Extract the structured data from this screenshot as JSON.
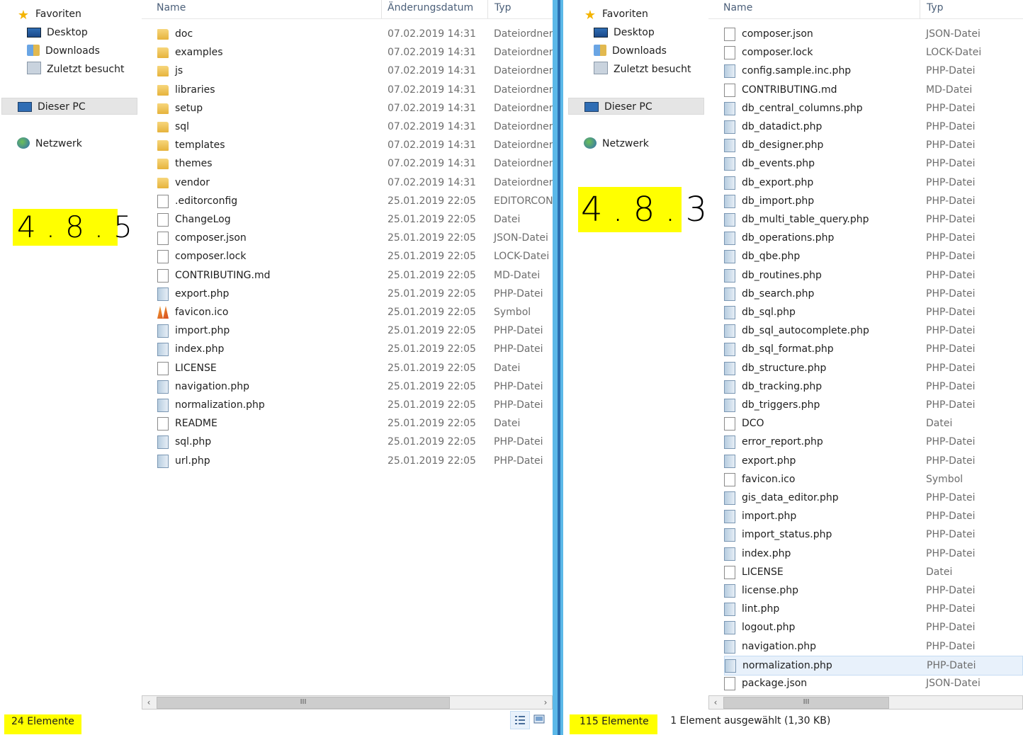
{
  "nav": {
    "favorites": "Favoriten",
    "desktop": "Desktop",
    "downloads": "Downloads",
    "recent": "Zuletzt besucht",
    "this_pc": "Dieser PC",
    "network": "Netzwerk"
  },
  "left": {
    "headers": {
      "name": "Name",
      "date": "Änderungsdatum",
      "type": "Typ"
    },
    "annotation": "4.8.5",
    "status_count": "24 Elemente",
    "files": [
      {
        "name": "doc",
        "date": "07.02.2019 14:31",
        "type": "Dateiordner",
        "icon": "folder"
      },
      {
        "name": "examples",
        "date": "07.02.2019 14:31",
        "type": "Dateiordner",
        "icon": "folder"
      },
      {
        "name": "js",
        "date": "07.02.2019 14:31",
        "type": "Dateiordner",
        "icon": "folder"
      },
      {
        "name": "libraries",
        "date": "07.02.2019 14:31",
        "type": "Dateiordner",
        "icon": "folder"
      },
      {
        "name": "setup",
        "date": "07.02.2019 14:31",
        "type": "Dateiordner",
        "icon": "folder"
      },
      {
        "name": "sql",
        "date": "07.02.2019 14:31",
        "type": "Dateiordner",
        "icon": "folder"
      },
      {
        "name": "templates",
        "date": "07.02.2019 14:31",
        "type": "Dateiordner",
        "icon": "folder"
      },
      {
        "name": "themes",
        "date": "07.02.2019 14:31",
        "type": "Dateiordner",
        "icon": "folder"
      },
      {
        "name": "vendor",
        "date": "07.02.2019 14:31",
        "type": "Dateiordner",
        "icon": "folder"
      },
      {
        "name": ".editorconfig",
        "date": "25.01.2019 22:05",
        "type": "EDITORCON",
        "icon": "file"
      },
      {
        "name": "ChangeLog",
        "date": "25.01.2019 22:05",
        "type": "Datei",
        "icon": "file"
      },
      {
        "name": "composer.json",
        "date": "25.01.2019 22:05",
        "type": "JSON-Datei",
        "icon": "file"
      },
      {
        "name": "composer.lock",
        "date": "25.01.2019 22:05",
        "type": "LOCK-Datei",
        "icon": "file"
      },
      {
        "name": "CONTRIBUTING.md",
        "date": "25.01.2019 22:05",
        "type": "MD-Datei",
        "icon": "file"
      },
      {
        "name": "export.php",
        "date": "25.01.2019 22:05",
        "type": "PHP-Datei",
        "icon": "php"
      },
      {
        "name": "favicon.ico",
        "date": "25.01.2019 22:05",
        "type": "Symbol",
        "icon": "fav"
      },
      {
        "name": "import.php",
        "date": "25.01.2019 22:05",
        "type": "PHP-Datei",
        "icon": "php"
      },
      {
        "name": "index.php",
        "date": "25.01.2019 22:05",
        "type": "PHP-Datei",
        "icon": "php"
      },
      {
        "name": "LICENSE",
        "date": "25.01.2019 22:05",
        "type": "Datei",
        "icon": "file"
      },
      {
        "name": "navigation.php",
        "date": "25.01.2019 22:05",
        "type": "PHP-Datei",
        "icon": "php"
      },
      {
        "name": "normalization.php",
        "date": "25.01.2019 22:05",
        "type": "PHP-Datei",
        "icon": "php"
      },
      {
        "name": "README",
        "date": "25.01.2019 22:05",
        "type": "Datei",
        "icon": "file"
      },
      {
        "name": "sql.php",
        "date": "25.01.2019 22:05",
        "type": "PHP-Datei",
        "icon": "php"
      },
      {
        "name": "url.php",
        "date": "25.01.2019 22:05",
        "type": "PHP-Datei",
        "icon": "php"
      }
    ]
  },
  "right": {
    "headers": {
      "name": "Name",
      "type": "Typ"
    },
    "annotation": "4.8.3",
    "status_count": "115 Elemente",
    "status_selection": "1 Element ausgewählt (1,30 KB)",
    "files": [
      {
        "name": "composer.json",
        "type": "JSON-Datei",
        "icon": "file"
      },
      {
        "name": "composer.lock",
        "type": "LOCK-Datei",
        "icon": "file"
      },
      {
        "name": "config.sample.inc.php",
        "type": "PHP-Datei",
        "icon": "php"
      },
      {
        "name": "CONTRIBUTING.md",
        "type": "MD-Datei",
        "icon": "file"
      },
      {
        "name": "db_central_columns.php",
        "type": "PHP-Datei",
        "icon": "php"
      },
      {
        "name": "db_datadict.php",
        "type": "PHP-Datei",
        "icon": "php"
      },
      {
        "name": "db_designer.php",
        "type": "PHP-Datei",
        "icon": "php"
      },
      {
        "name": "db_events.php",
        "type": "PHP-Datei",
        "icon": "php"
      },
      {
        "name": "db_export.php",
        "type": "PHP-Datei",
        "icon": "php"
      },
      {
        "name": "db_import.php",
        "type": "PHP-Datei",
        "icon": "php"
      },
      {
        "name": "db_multi_table_query.php",
        "type": "PHP-Datei",
        "icon": "php"
      },
      {
        "name": "db_operations.php",
        "type": "PHP-Datei",
        "icon": "php"
      },
      {
        "name": "db_qbe.php",
        "type": "PHP-Datei",
        "icon": "php"
      },
      {
        "name": "db_routines.php",
        "type": "PHP-Datei",
        "icon": "php"
      },
      {
        "name": "db_search.php",
        "type": "PHP-Datei",
        "icon": "php"
      },
      {
        "name": "db_sql.php",
        "type": "PHP-Datei",
        "icon": "php"
      },
      {
        "name": "db_sql_autocomplete.php",
        "type": "PHP-Datei",
        "icon": "php"
      },
      {
        "name": "db_sql_format.php",
        "type": "PHP-Datei",
        "icon": "php"
      },
      {
        "name": "db_structure.php",
        "type": "PHP-Datei",
        "icon": "php"
      },
      {
        "name": "db_tracking.php",
        "type": "PHP-Datei",
        "icon": "php"
      },
      {
        "name": "db_triggers.php",
        "type": "PHP-Datei",
        "icon": "php"
      },
      {
        "name": "DCO",
        "type": "Datei",
        "icon": "file"
      },
      {
        "name": "error_report.php",
        "type": "PHP-Datei",
        "icon": "php"
      },
      {
        "name": "export.php",
        "type": "PHP-Datei",
        "icon": "php"
      },
      {
        "name": "favicon.ico",
        "type": "Symbol",
        "icon": "file"
      },
      {
        "name": "gis_data_editor.php",
        "type": "PHP-Datei",
        "icon": "php"
      },
      {
        "name": "import.php",
        "type": "PHP-Datei",
        "icon": "php"
      },
      {
        "name": "import_status.php",
        "type": "PHP-Datei",
        "icon": "php"
      },
      {
        "name": "index.php",
        "type": "PHP-Datei",
        "icon": "php"
      },
      {
        "name": "LICENSE",
        "type": "Datei",
        "icon": "file"
      },
      {
        "name": "license.php",
        "type": "PHP-Datei",
        "icon": "php"
      },
      {
        "name": "lint.php",
        "type": "PHP-Datei",
        "icon": "php"
      },
      {
        "name": "logout.php",
        "type": "PHP-Datei",
        "icon": "php"
      },
      {
        "name": "navigation.php",
        "type": "PHP-Datei",
        "icon": "php"
      },
      {
        "name": "normalization.php",
        "type": "PHP-Datei",
        "icon": "php",
        "selected": true
      },
      {
        "name": "package.json",
        "type": "JSON-Datei",
        "icon": "file"
      }
    ]
  },
  "scroll_grip": "III"
}
